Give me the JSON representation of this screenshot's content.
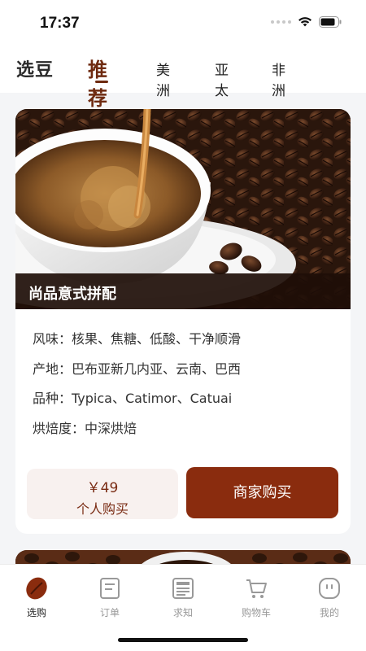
{
  "status_bar": {
    "time": "17:37"
  },
  "header": {
    "logo": "选豆",
    "tabs": [
      {
        "label": "推荐",
        "active": true
      },
      {
        "label": "美洲",
        "active": false
      },
      {
        "label": "亚太",
        "active": false
      },
      {
        "label": "非洲",
        "active": false
      }
    ]
  },
  "product": {
    "title": "尚品意式拼配",
    "specs": [
      "风味：核果、焦糖、低酸、干净顺滑",
      "产地：巴布亚新几内亚、云南、巴西",
      "品种：Typica、Catimor、Catuai",
      "烘焙度：中深烘焙"
    ],
    "personal_price": "￥49",
    "personal_label": "个人购买",
    "merchant_label": "商家购买"
  },
  "bottom_nav": {
    "items": [
      {
        "label": "选购",
        "icon": "coffee-bean-icon",
        "active": true
      },
      {
        "label": "订单",
        "icon": "order-list-icon",
        "active": false
      },
      {
        "label": "求知",
        "icon": "newspaper-icon",
        "active": false
      },
      {
        "label": "购物车",
        "icon": "shopping-cart-icon",
        "active": false
      },
      {
        "label": "我的",
        "icon": "profile-face-icon",
        "active": false
      }
    ]
  },
  "colors": {
    "accent": "#6e2a10",
    "merchant_button": "#8a2c0e",
    "personal_button": "#f8f1ef"
  }
}
